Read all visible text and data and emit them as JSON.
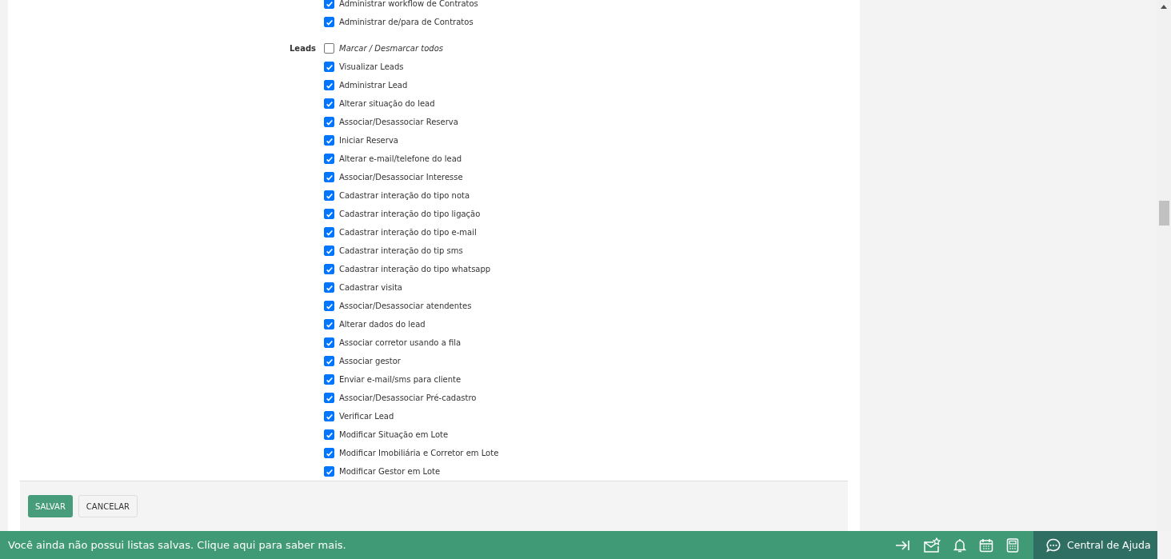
{
  "groups": [
    {
      "permissions": [
        {
          "label": "Administrar workflow de Contratos",
          "checked": true
        },
        {
          "label": "Administrar de/para de Contratos",
          "checked": true
        }
      ]
    },
    {
      "label": "Leads",
      "toggle_all": {
        "label": "Marcar / Desmarcar todos",
        "checked": false
      },
      "permissions": [
        {
          "label": "Visualizar Leads",
          "checked": true
        },
        {
          "label": "Administrar Lead",
          "checked": true
        },
        {
          "label": "Alterar situação do lead",
          "checked": true
        },
        {
          "label": "Associar/Desassociar Reserva",
          "checked": true
        },
        {
          "label": "Iniciar Reserva",
          "checked": true
        },
        {
          "label": "Alterar e-mail/telefone do lead",
          "checked": true
        },
        {
          "label": "Associar/Desassociar Interesse",
          "checked": true
        },
        {
          "label": "Cadastrar interação do tipo nota",
          "checked": true
        },
        {
          "label": "Cadastrar interação do tipo ligação",
          "checked": true
        },
        {
          "label": "Cadastrar interação do tipo e-mail",
          "checked": true
        },
        {
          "label": "Cadastrar interação do tip sms",
          "checked": true
        },
        {
          "label": "Cadastrar interação do tipo whatsapp",
          "checked": true
        },
        {
          "label": "Cadastrar visita",
          "checked": true
        },
        {
          "label": "Associar/Desassociar atendentes",
          "checked": true
        },
        {
          "label": "Alterar dados do lead",
          "checked": true
        },
        {
          "label": "Associar corretor usando a fila",
          "checked": true
        },
        {
          "label": "Associar gestor",
          "checked": true
        },
        {
          "label": "Enviar e-mail/sms para cliente",
          "checked": true
        },
        {
          "label": "Associar/Desassociar Pré-cadastro",
          "checked": true
        },
        {
          "label": "Verificar Lead",
          "checked": true
        },
        {
          "label": "Modificar Situação em Lote",
          "checked": true
        },
        {
          "label": "Modificar Imobiliária e Corretor em Lote",
          "checked": true
        },
        {
          "label": "Modificar Gestor em Lote",
          "checked": true
        }
      ]
    }
  ],
  "buttons": [
    {
      "label": "SALVAR",
      "kind": "primary"
    },
    {
      "label": "CANCELAR",
      "kind": "secondary"
    }
  ],
  "status_bar": {
    "message": "Você ainda não possui listas salvas. Clique aqui para saber mais.",
    "help": "Central de Ajuda"
  }
}
